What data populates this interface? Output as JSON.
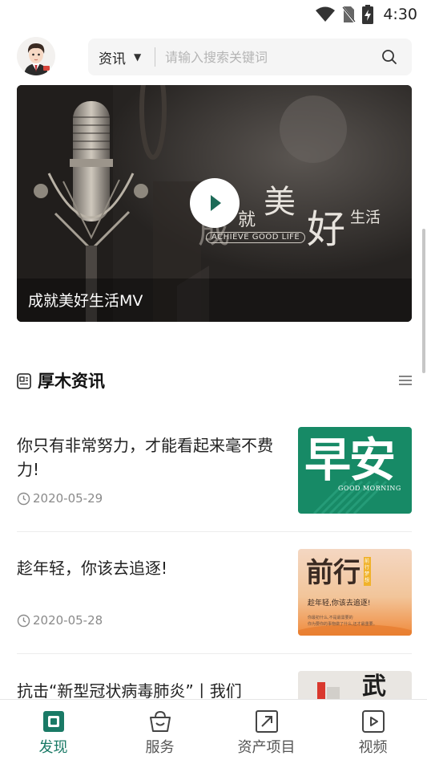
{
  "status_bar": {
    "time": "4:30"
  },
  "search": {
    "category": "资讯",
    "placeholder": "请输入搜索关键词"
  },
  "banner": {
    "caption": "成就美好生活MV",
    "slogan_char_1": "成",
    "slogan_char_2": "就",
    "slogan_char_3": "美",
    "slogan_char_4": "好",
    "slogan_char_5": "生活",
    "slogan_sub": "ACHIEVE GOOD LIFE"
  },
  "section": {
    "title": "厚木资讯"
  },
  "news": [
    {
      "headline": "你只有非常努力，才能看起来毫不费力!",
      "date": "2020-05-29",
      "thumb_text": "早安",
      "thumb_sub": "GOOD MORNING"
    },
    {
      "headline": "趁年轻，你该去追逐!",
      "date": "2020-05-28",
      "thumb_text": "前行",
      "thumb_tag": "前行梦想",
      "thumb_sub": "趁年轻,你该去追逐!",
      "thumb_fine_1": "你最初什么,不是最需要的",
      "thumb_fine_2": "你为要你的事物做了什么,还才最重要。"
    },
    {
      "headline": "抗击“新型冠状病毒肺炎”丨我们",
      "thumb_text": "武"
    }
  ],
  "tabs": [
    {
      "label": "发现",
      "icon": "discover-icon",
      "active": true
    },
    {
      "label": "服务",
      "icon": "service-basket-icon",
      "active": false
    },
    {
      "label": "资产项目",
      "icon": "asset-project-icon",
      "active": false
    },
    {
      "label": "视频",
      "icon": "video-play-icon",
      "active": false
    }
  ],
  "colors": {
    "accent": "#1a7a66",
    "thumb_green": "#178a66"
  }
}
